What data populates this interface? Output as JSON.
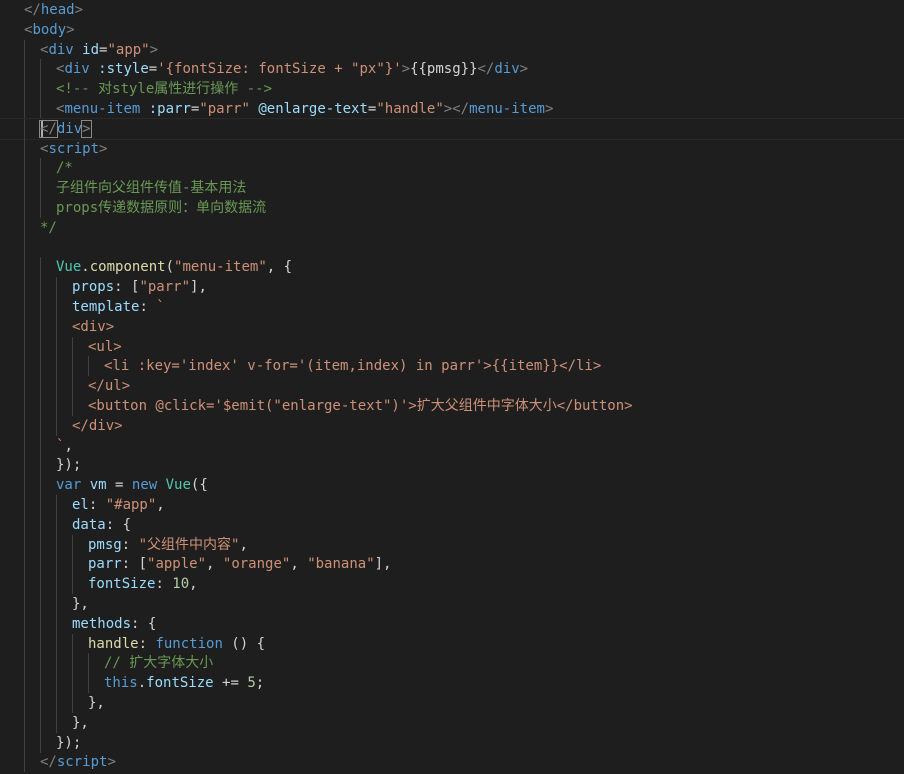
{
  "editor": {
    "theme": "dark",
    "background": "#1e1e1e",
    "language": "html",
    "lines": [
      [
        [
          "brk",
          "</"
        ],
        [
          "tag",
          "head"
        ],
        [
          "brk",
          ">"
        ]
      ],
      [
        [
          "brk",
          "<"
        ],
        [
          "tag",
          "body"
        ],
        [
          "brk",
          ">"
        ]
      ],
      [
        [
          "brk",
          "<"
        ],
        [
          "tag",
          "div"
        ],
        [
          "txt",
          " "
        ],
        [
          "attr",
          "id"
        ],
        [
          "txt",
          "="
        ],
        [
          "str",
          "\"app\""
        ],
        [
          "brk",
          ">"
        ]
      ],
      [
        [
          "brk",
          "<"
        ],
        [
          "tag",
          "div"
        ],
        [
          "txt",
          " "
        ],
        [
          "attr",
          ":style"
        ],
        [
          "txt",
          "="
        ],
        [
          "str",
          "'{fontSize: fontSize + \"px\"}'"
        ],
        [
          "brk",
          ">"
        ],
        [
          "txt",
          "{{pmsg}}"
        ],
        [
          "brk",
          "</"
        ],
        [
          "tag",
          "div"
        ],
        [
          "brk",
          ">"
        ]
      ],
      [
        [
          "com",
          "<!-- 对style属性进行操作 -->"
        ]
      ],
      [
        [
          "brk",
          "<"
        ],
        [
          "tag",
          "menu-item"
        ],
        [
          "txt",
          " "
        ],
        [
          "attr",
          ":parr"
        ],
        [
          "txt",
          "="
        ],
        [
          "str",
          "\"parr\""
        ],
        [
          "txt",
          " "
        ],
        [
          "attr",
          "@enlarge-text"
        ],
        [
          "txt",
          "="
        ],
        [
          "str",
          "\"handle\""
        ],
        [
          "brk",
          "></"
        ],
        [
          "tag",
          "menu-item"
        ],
        [
          "brk",
          ">"
        ]
      ],
      [
        [
          "brk",
          "</"
        ],
        [
          "tag",
          "div"
        ],
        [
          "brk",
          ">"
        ]
      ],
      [
        [
          "brk",
          "<"
        ],
        [
          "tag",
          "script"
        ],
        [
          "brk",
          ">"
        ]
      ],
      [
        [
          "com",
          "/*"
        ]
      ],
      [
        [
          "com",
          "子组件向父组件传值-基本用法"
        ]
      ],
      [
        [
          "com",
          "props传递数据原则：单向数据流"
        ]
      ],
      [
        [
          "com",
          "*/"
        ]
      ],
      [],
      [
        [
          "cls",
          "Vue"
        ],
        [
          "txt",
          "."
        ],
        [
          "fn",
          "component"
        ],
        [
          "txt",
          "("
        ],
        [
          "str",
          "\"menu-item\""
        ],
        [
          "txt",
          ", {"
        ]
      ],
      [
        [
          "prop",
          "props"
        ],
        [
          "txt",
          ": ["
        ],
        [
          "str",
          "\"parr\""
        ],
        [
          "txt",
          "],"
        ]
      ],
      [
        [
          "prop",
          "template"
        ],
        [
          "txt",
          ": "
        ],
        [
          "str",
          "`"
        ]
      ],
      [
        [
          "str",
          "<div>"
        ]
      ],
      [
        [
          "str",
          "<ul>"
        ]
      ],
      [
        [
          "str",
          "<li :key='index' v-for='(item,index) in parr'>{{item}}</li>"
        ]
      ],
      [
        [
          "str",
          "</ul>"
        ]
      ],
      [
        [
          "str",
          "<button @click='$emit(\"enlarge-text\")'>扩大父组件中字体大小</button>"
        ]
      ],
      [
        [
          "str",
          "</div>"
        ]
      ],
      [
        [
          "str",
          "`"
        ],
        [
          "txt",
          ","
        ]
      ],
      [
        [
          "txt",
          "});"
        ]
      ],
      [
        [
          "kw",
          "var"
        ],
        [
          "txt",
          " "
        ],
        [
          "var",
          "vm"
        ],
        [
          "txt",
          " = "
        ],
        [
          "kw",
          "new"
        ],
        [
          "txt",
          " "
        ],
        [
          "cls",
          "Vue"
        ],
        [
          "txt",
          "({"
        ]
      ],
      [
        [
          "prop",
          "el"
        ],
        [
          "txt",
          ": "
        ],
        [
          "str",
          "\"#app\""
        ],
        [
          "txt",
          ","
        ]
      ],
      [
        [
          "prop",
          "data"
        ],
        [
          "txt",
          ": {"
        ]
      ],
      [
        [
          "prop",
          "pmsg"
        ],
        [
          "txt",
          ": "
        ],
        [
          "str",
          "\"父组件中内容\""
        ],
        [
          "txt",
          ","
        ]
      ],
      [
        [
          "prop",
          "parr"
        ],
        [
          "txt",
          ": ["
        ],
        [
          "str",
          "\"apple\""
        ],
        [
          "txt",
          ", "
        ],
        [
          "str",
          "\"orange\""
        ],
        [
          "txt",
          ", "
        ],
        [
          "str",
          "\"banana\""
        ],
        [
          "txt",
          "],"
        ]
      ],
      [
        [
          "prop",
          "fontSize"
        ],
        [
          "txt",
          ": "
        ],
        [
          "num",
          "10"
        ],
        [
          "txt",
          ","
        ]
      ],
      [
        [
          "txt",
          "},"
        ]
      ],
      [
        [
          "prop",
          "methods"
        ],
        [
          "txt",
          ": {"
        ]
      ],
      [
        [
          "fn",
          "handle"
        ],
        [
          "txt",
          ": "
        ],
        [
          "kw",
          "function"
        ],
        [
          "txt",
          " () {"
        ]
      ],
      [
        [
          "com",
          "// 扩大字体大小"
        ]
      ],
      [
        [
          "kw",
          "this"
        ],
        [
          "txt",
          "."
        ],
        [
          "prop",
          "fontSize"
        ],
        [
          "txt",
          " += "
        ],
        [
          "num",
          "5"
        ],
        [
          "txt",
          ";"
        ]
      ],
      [
        [
          "txt",
          "},"
        ]
      ],
      [
        [
          "txt",
          "},"
        ]
      ],
      [
        [
          "txt",
          "});"
        ]
      ],
      [
        [
          "brk",
          "</"
        ],
        [
          "tag",
          "script"
        ],
        [
          "brk",
          ">"
        ]
      ]
    ]
  }
}
